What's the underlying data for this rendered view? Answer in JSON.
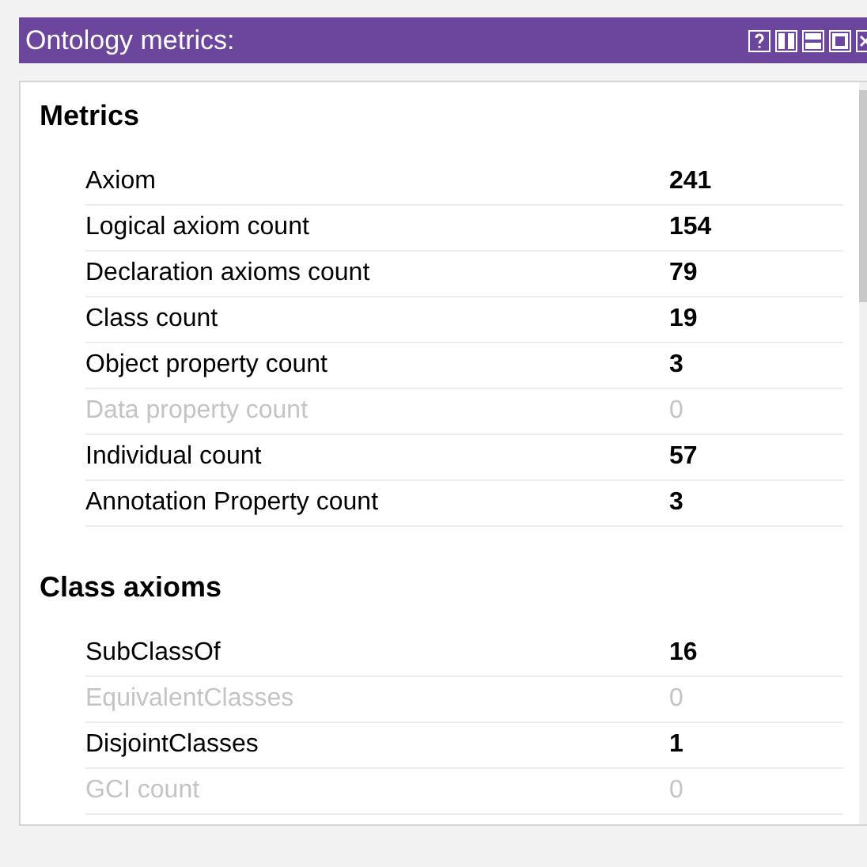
{
  "window": {
    "title": "Ontology metrics:"
  },
  "sections": [
    {
      "title": "Metrics",
      "rows": [
        {
          "label": "Axiom",
          "value": "241",
          "disabled": false
        },
        {
          "label": "Logical axiom count",
          "value": "154",
          "disabled": false
        },
        {
          "label": "Declaration axioms count",
          "value": "79",
          "disabled": false
        },
        {
          "label": "Class count",
          "value": "19",
          "disabled": false
        },
        {
          "label": "Object property count",
          "value": "3",
          "disabled": false
        },
        {
          "label": "Data property count",
          "value": "0",
          "disabled": true
        },
        {
          "label": "Individual count",
          "value": "57",
          "disabled": false
        },
        {
          "label": "Annotation Property count",
          "value": "3",
          "disabled": false
        }
      ]
    },
    {
      "title": "Class axioms",
      "rows": [
        {
          "label": "SubClassOf",
          "value": "16",
          "disabled": false
        },
        {
          "label": "EquivalentClasses",
          "value": "0",
          "disabled": true
        },
        {
          "label": "DisjointClasses",
          "value": "1",
          "disabled": false
        },
        {
          "label": "GCI count",
          "value": "0",
          "disabled": true
        }
      ]
    }
  ]
}
